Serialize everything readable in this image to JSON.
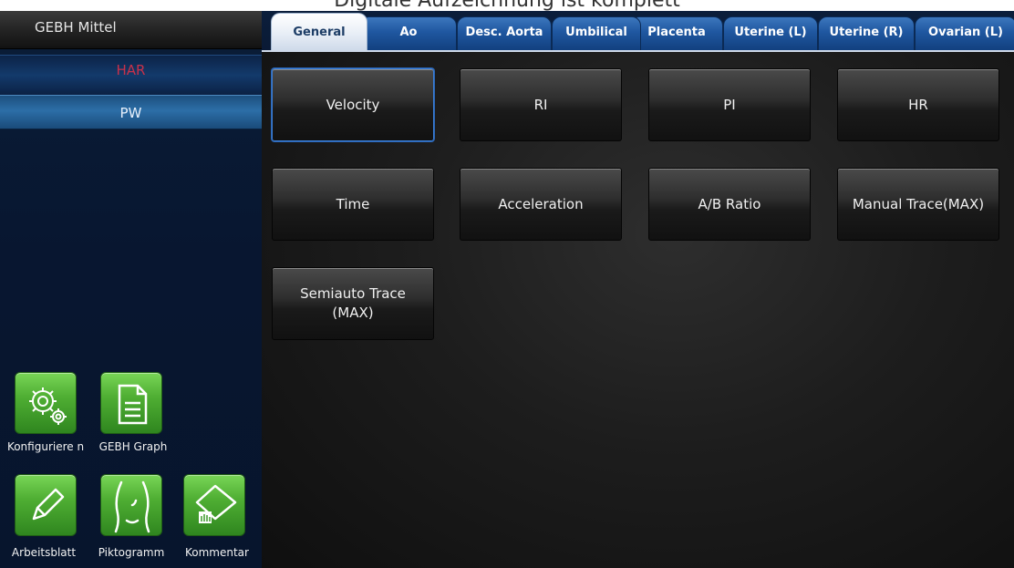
{
  "top_caption": "Digitale Aufzeichnung ist komplett",
  "sidebar": {
    "header": "GEBH Mittel",
    "modes": [
      "HAR",
      "PW"
    ],
    "tools": [
      {
        "label": "Konfiguriere n",
        "icon": "gears-icon"
      },
      {
        "label": "GEBH Graph",
        "icon": "document-icon"
      },
      {
        "label": "Arbeitsblatt",
        "icon": "pencil-icon"
      },
      {
        "label": "Piktogramm",
        "icon": "body-pictogram-icon"
      },
      {
        "label": "Kommentar",
        "icon": "comment-icon"
      }
    ]
  },
  "tabs": [
    "General",
    "Ao",
    "Desc. Aorta",
    "Umbilical",
    "Placenta",
    "Uterine (L)",
    "Uterine (R)",
    "Ovarian (L)"
  ],
  "active_tab": "General",
  "measurements": [
    "Velocity",
    "RI",
    "PI",
    "HR",
    "Time",
    "Acceleration",
    "A/B Ratio",
    "Manual Trace(MAX)",
    "Semiauto Trace (MAX)"
  ],
  "selected_measurement": "Velocity",
  "colors": {
    "accent_green": "#4fae33",
    "tab_blue": "#1f57a0",
    "mode_selected": "#2c6ea7",
    "har_red": "#c8314a"
  }
}
